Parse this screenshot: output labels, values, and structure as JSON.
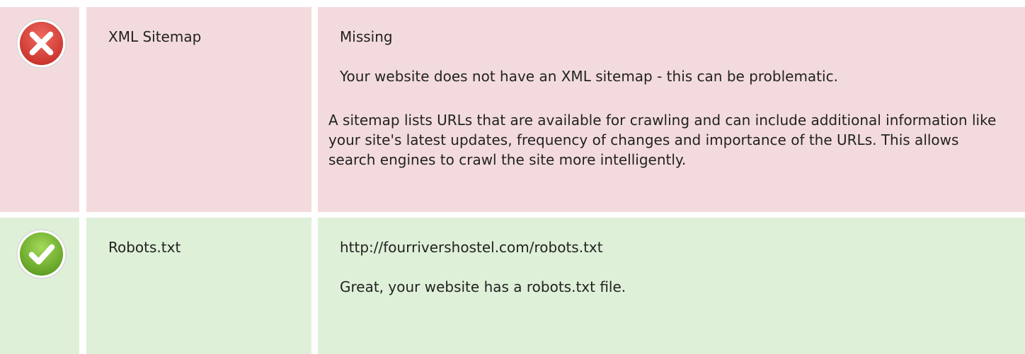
{
  "rows": [
    {
      "status": "error",
      "icon": "error-x-icon",
      "label": "XML Sitemap",
      "value": "Missing",
      "message": "Your website does not have an XML sitemap - this can be problematic.",
      "description": "A sitemap lists URLs that are available for crawling and can include additional information like your site's latest updates, frequency of changes and importance of the URLs. This allows search engines to crawl the site more intelligently."
    },
    {
      "status": "success",
      "icon": "success-check-icon",
      "label": "Robots.txt",
      "value": "http://fourrivershostel.com/robots.txt",
      "message": "Great, your website has a robots.txt file."
    }
  ],
  "colors": {
    "error_bg": "#f3dbdd",
    "success_bg": "#dff0d8",
    "error_icon": "#d9433d",
    "success_icon": "#6aa827"
  }
}
